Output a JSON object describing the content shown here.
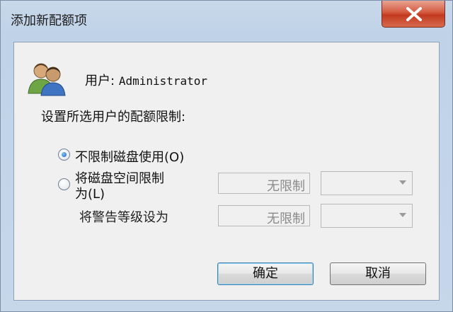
{
  "window": {
    "title": "添加新配额项"
  },
  "user": {
    "label": "用户:",
    "name": "Administrator"
  },
  "prompt": "设置所选用户的配额限制:",
  "options": {
    "no_limit": {
      "label": "不限制磁盘使用(O)",
      "selected": true
    },
    "limit": {
      "label_line1": "将磁盘空间限制",
      "label_line2": "为(L)",
      "selected": false,
      "value": "无限制"
    },
    "warning": {
      "label": "将警告等级设为",
      "value": "无限制"
    }
  },
  "buttons": {
    "ok": "确定",
    "cancel": "取消"
  },
  "colors": {
    "close_button": "#d4593f",
    "default_button_border": "#3c7fb1",
    "radio_selected": "#1d5fb8"
  }
}
